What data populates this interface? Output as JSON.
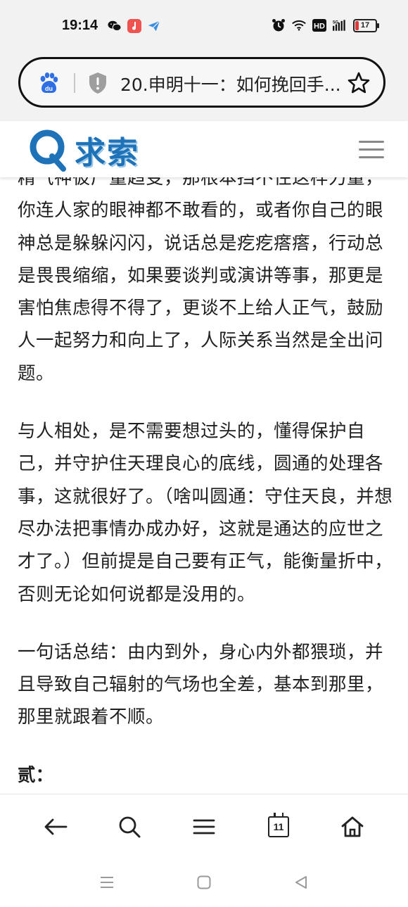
{
  "status_bar": {
    "time": "19:14",
    "battery_level": "17",
    "network": "5G",
    "left_icons": [
      "wechat-icon",
      "music-app-icon",
      "send-app-icon"
    ],
    "right_icons": [
      "alarm-icon",
      "wifi-icon",
      "hd-icon",
      "signal-icon",
      "battery-icon"
    ]
  },
  "address_bar": {
    "title": "20.申明十一：如何挽回手..."
  },
  "site": {
    "logo_text": "求索",
    "brand_color": "#1e72b8"
  },
  "article": {
    "paragraphs": [
      "精气神彼广量趋变，那根本挡不住这样力量，你连人家的眼神都不敢看的，或者你自己的眼神总是躲躲闪闪，说话总是疙疙瘩瘩，行动总是畏畏缩缩，如果要谈判或演讲等事，那更是害怕焦虑得不得了，更谈不上给人正气，鼓励人一起努力和向上了，人际关系当然是全出问题。",
      "与人相处，是不需要想过头的，懂得保护自己，并守护住天理良心的底线，圆通的处理各事，这就很好了。（啥叫圆通：守住天良，并想尽办法把事情办成办好，这就是通达的应世之才了。）但前提是自己要有正气，能衡量折中，否则无论如何说都是没用的。",
      "一句话总结：由内到外，身心内外都猥琐，并且导致自己辐射的气场也全差，基本到那里，那里就跟着不顺。"
    ],
    "section_label": "贰："
  },
  "toolbar": {
    "tab_count": "11",
    "buttons": [
      "back-icon",
      "search-icon",
      "menu-icon",
      "tabs-icon",
      "home-icon"
    ]
  },
  "system_nav": [
    "recents-icon",
    "home-circle-icon",
    "back-triangle-icon"
  ]
}
